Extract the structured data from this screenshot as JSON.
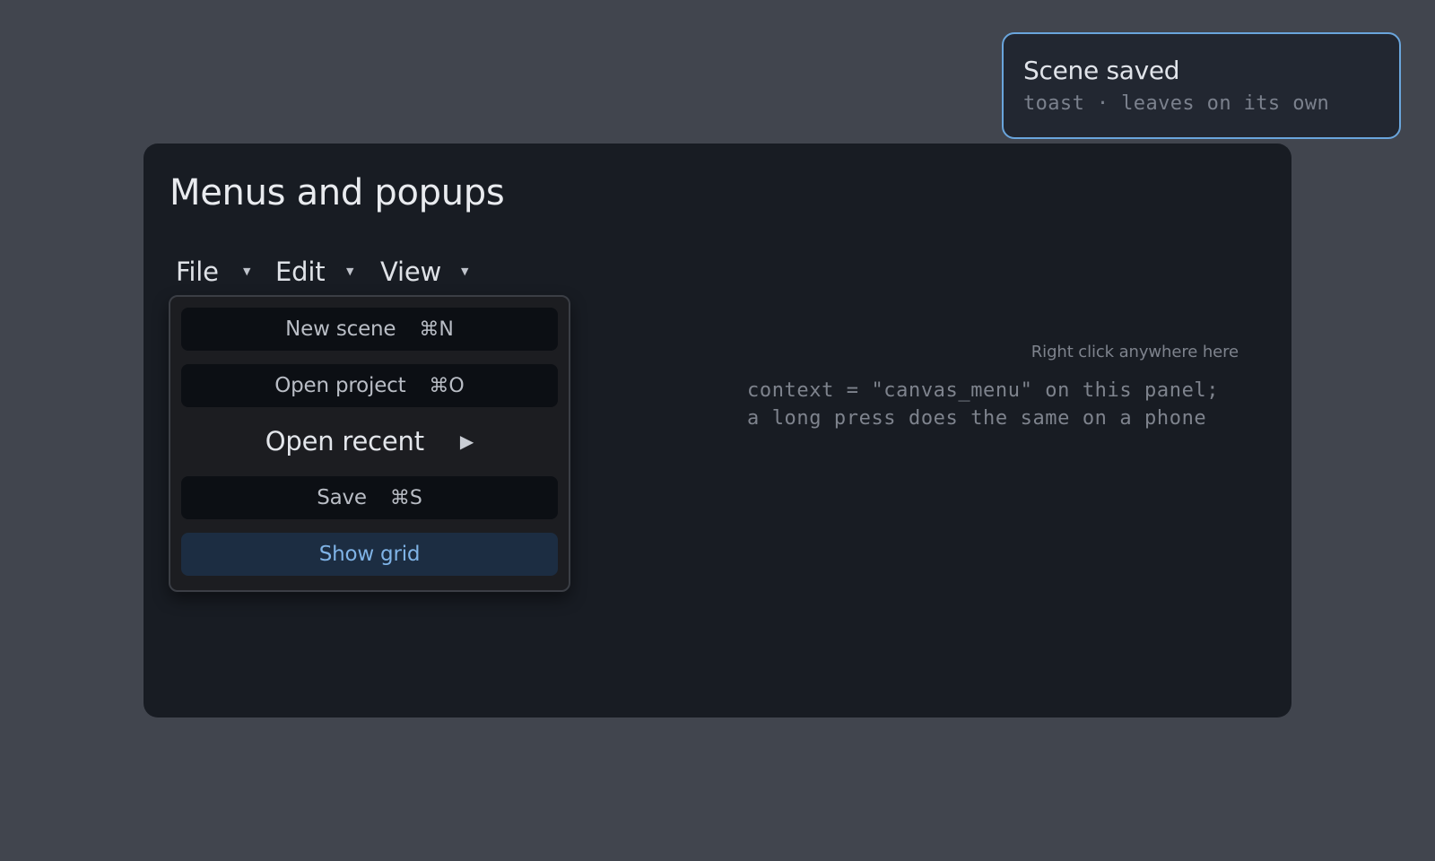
{
  "toast": {
    "title": "Scene saved",
    "subtitle": "toast · leaves on its own"
  },
  "panel": {
    "title": "Menus and popups",
    "hint_label": "Right click anywhere here",
    "hint_code_line1": "context = \"canvas_menu\" on this panel;",
    "hint_code_line2": "a long press does the same on a phone"
  },
  "menubar": {
    "menus": [
      {
        "label": "File"
      },
      {
        "label": "Edit"
      },
      {
        "label": "View"
      }
    ]
  },
  "file_menu": {
    "items": [
      {
        "label": "New scene",
        "shortcut": "⌘N"
      },
      {
        "label": "Open project",
        "shortcut": "⌘O"
      },
      {
        "label": "Open recent",
        "submenu_icon": "triangle-right-icon"
      },
      {
        "label": "Save",
        "shortcut": "⌘S"
      },
      {
        "label": "Show grid",
        "state": "highlighted"
      }
    ]
  },
  "colors": {
    "background": "#41454e",
    "panel": "#181c23",
    "toast_border": "#6aa5dc",
    "highlight": "#1c2d42",
    "highlight_text": "#7fb3e6"
  }
}
